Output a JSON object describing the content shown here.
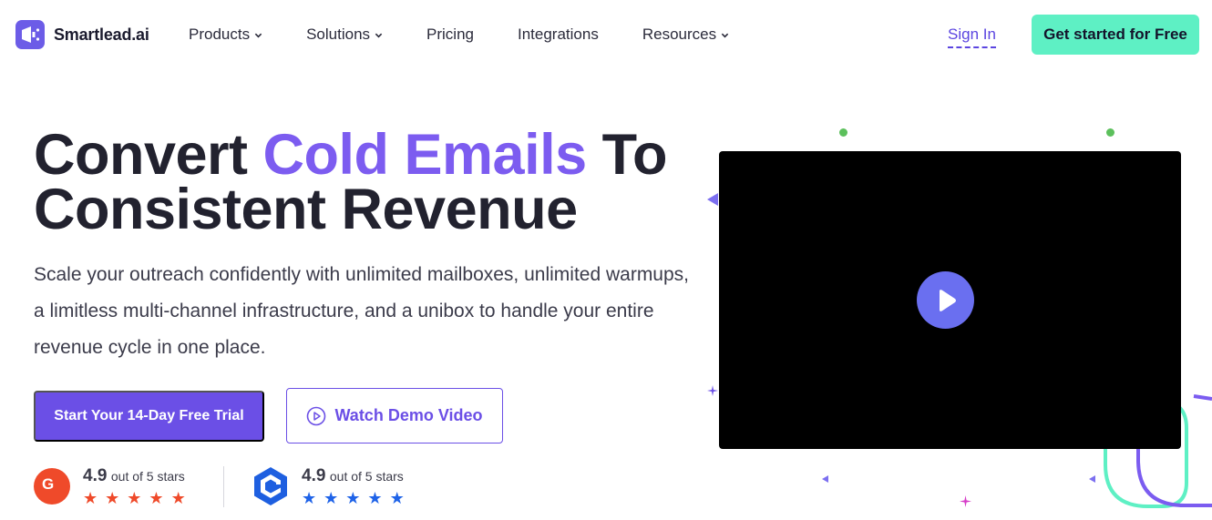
{
  "brand": {
    "name": "Smartlead.ai"
  },
  "nav": {
    "items": [
      {
        "label": "Products",
        "has_dropdown": true
      },
      {
        "label": "Solutions",
        "has_dropdown": true
      },
      {
        "label": "Pricing",
        "has_dropdown": false
      },
      {
        "label": "Integrations",
        "has_dropdown": false
      },
      {
        "label": "Resources",
        "has_dropdown": true
      }
    ],
    "sign_in": "Sign In",
    "cta": "Get started for Free"
  },
  "hero": {
    "title_part1": "Convert ",
    "title_accent": "Cold Emails",
    "title_part2": " To",
    "title_line2": "Consistent Revenue",
    "subtitle": "Scale your outreach confidently with unlimited mailboxes, unlimited warmups, a limitless multi-channel infrastructure, and a unibox to handle your entire revenue cycle in one place.",
    "primary_button": "Start Your 14-Day Free Trial",
    "secondary_button": "Watch Demo Video"
  },
  "ratings": [
    {
      "source_icon": "g2-logo-icon",
      "badge_text": "G",
      "score": "4.9",
      "suffix": "out of 5 stars",
      "stars": 5,
      "color": "#ef4a2a"
    },
    {
      "source_icon": "capterra-logo-icon",
      "score": "4.9",
      "suffix": "out of 5 stars",
      "stars": 5,
      "color": "#1f63e8"
    }
  ],
  "colors": {
    "accent": "#7c5cf0",
    "primary_button": "#6b4fe6",
    "cta_mint": "#5ef0c4",
    "play_button": "#6a6ff0"
  }
}
